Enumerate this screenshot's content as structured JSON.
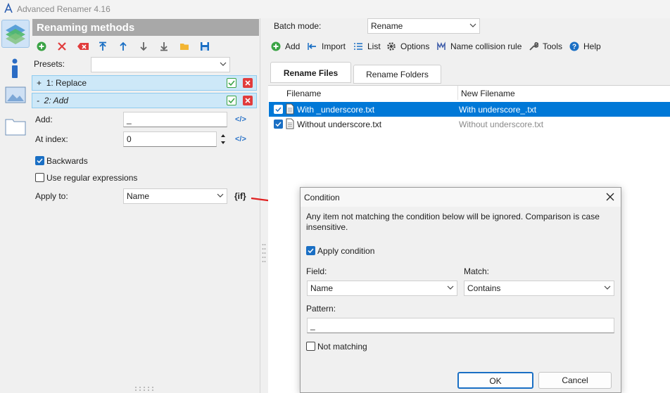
{
  "window": {
    "title": "Advanced Renamer 4.16"
  },
  "left": {
    "header": "Renaming methods",
    "presets_label": "Presets:",
    "methods": [
      {
        "toggle": "+",
        "label": "1: Replace"
      },
      {
        "toggle": "-",
        "label": "2: Add"
      }
    ],
    "add_label": "Add:",
    "add_value": "_",
    "index_label": "At index:",
    "index_value": "0",
    "backwards_label": "Backwards",
    "regex_label": "Use regular expressions",
    "apply_label": "Apply to:",
    "apply_value": "Name",
    "if_label": "{if}"
  },
  "right": {
    "batch_label": "Batch mode:",
    "batch_value": "Rename",
    "toolbar": {
      "add": "Add",
      "import": "Import",
      "list": "List",
      "options": "Options",
      "collision": "Name collision rule",
      "tools": "Tools",
      "help": "Help"
    },
    "tabs": [
      "Rename Files",
      "Rename Folders"
    ],
    "columns": [
      "Filename",
      "New Filename"
    ],
    "files": [
      {
        "name": "With _underscore.txt",
        "new": "With underscore_.txt"
      },
      {
        "name": "Without underscore.txt",
        "new": "Without underscore.txt"
      }
    ]
  },
  "dialog": {
    "title": "Condition",
    "description": "Any item not matching the condition below will be ignored. Comparison is case insensitive.",
    "apply_condition": "Apply condition",
    "field_label": "Field:",
    "field_value": "Name",
    "match_label": "Match:",
    "match_value": "Contains",
    "pattern_label": "Pattern:",
    "pattern_value": "_",
    "not_matching": "Not matching",
    "ok": "OK",
    "cancel": "Cancel"
  },
  "colors": {
    "accent": "#0078d7",
    "selection_row": "#0078d7",
    "method_row": "#cde8f8",
    "arrow": "#e02020"
  }
}
